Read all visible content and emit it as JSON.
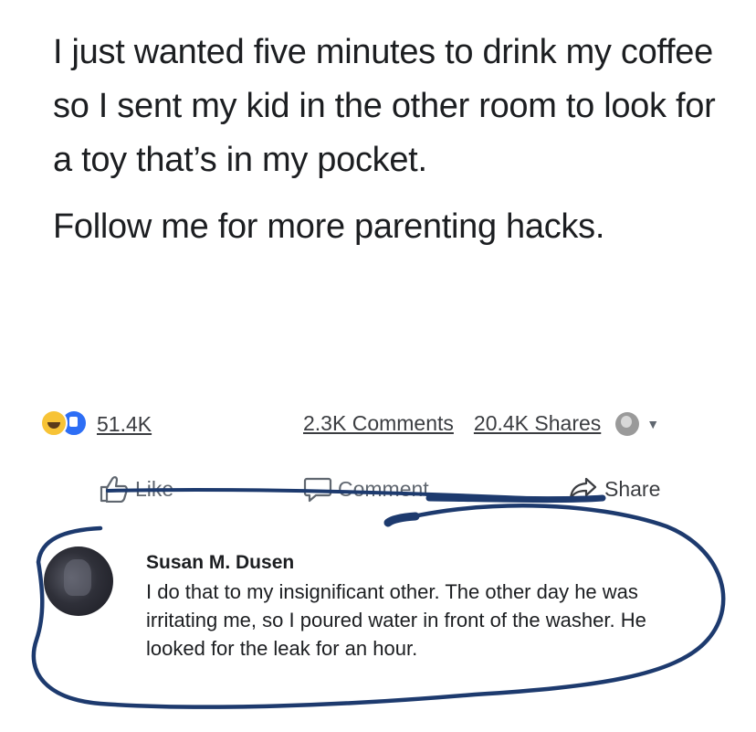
{
  "post": {
    "paragraph1": "I just wanted five minutes to drink my coffee so I sent my kid in the other room to look for a toy that’s in my pocket.",
    "paragraph2": "Follow me for more parenting hacks."
  },
  "stats": {
    "reaction_count": "51.4K",
    "comments": "2.3K Comments",
    "shares": "20.4K Shares"
  },
  "actions": {
    "like": "Like",
    "comment": "Comment",
    "share": "Share"
  },
  "comment": {
    "author": "Susan M. Dusen",
    "text": "I do that to my insignificant other.  The other day he was irritating me, so I poured water in front of the washer.  He looked for the leak for an hour."
  },
  "icons": {
    "reactions": [
      "haha-reaction-icon",
      "like-reaction-icon"
    ],
    "like": "thumbs-up-icon",
    "comment": "speech-bubble-icon",
    "share": "share-arrow-icon"
  },
  "colors": {
    "text": "#1c1e21",
    "secondary_text": "#606770",
    "marker_ink": "#1d3a6e",
    "like_blue": "#2d6ef5",
    "haha_yellow": "#f7c336"
  }
}
